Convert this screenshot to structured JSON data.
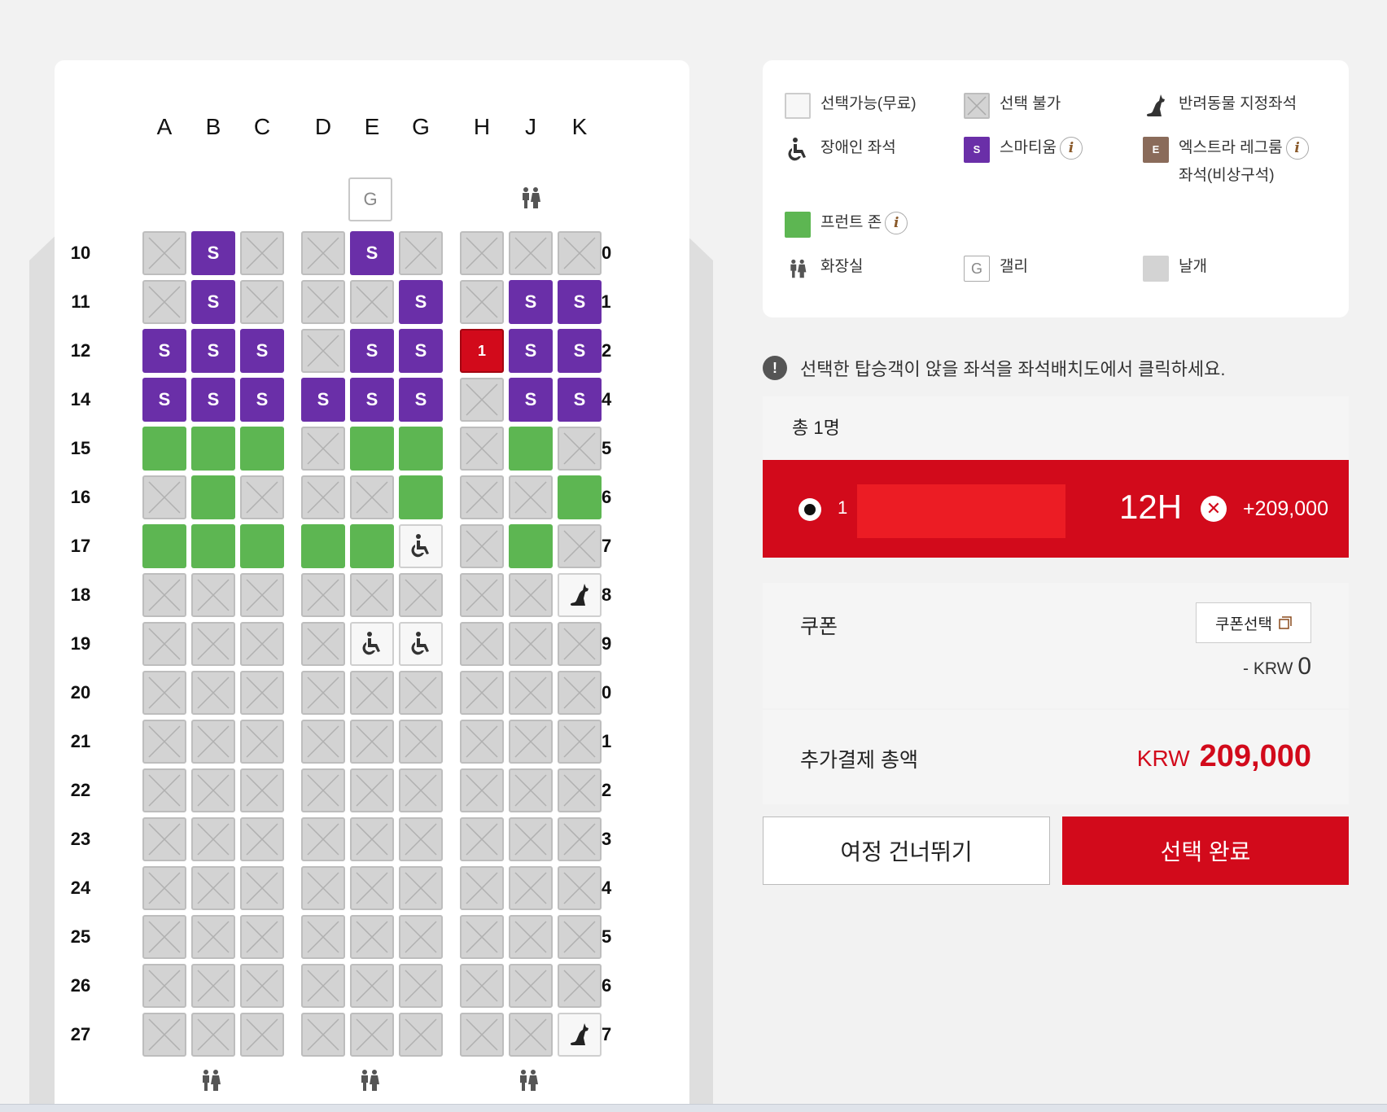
{
  "seatmap": {
    "columns": [
      "A",
      "B",
      "C",
      "D",
      "E",
      "G",
      "H",
      "J",
      "K"
    ],
    "galley_label": "G",
    "rows": [
      {
        "num": "10",
        "seats": [
          "X",
          "S",
          "X",
          "X",
          "S",
          "X",
          "X",
          "X",
          "X"
        ]
      },
      {
        "num": "11",
        "seats": [
          "X",
          "S",
          "X",
          "X",
          "X",
          "S",
          "X",
          "S",
          "S"
        ]
      },
      {
        "num": "12",
        "seats": [
          "S",
          "S",
          "S",
          "X",
          "S",
          "S",
          "SEL",
          "S",
          "S"
        ]
      },
      {
        "num": "14",
        "seats": [
          "S",
          "S",
          "S",
          "S",
          "S",
          "S",
          "X",
          "S",
          "S"
        ]
      },
      {
        "num": "15",
        "seats": [
          "F",
          "F",
          "F",
          "X",
          "F",
          "F",
          "X",
          "F",
          "X"
        ]
      },
      {
        "num": "16",
        "seats": [
          "X",
          "F",
          "X",
          "X",
          "X",
          "F",
          "X",
          "X",
          "F"
        ]
      },
      {
        "num": "17",
        "seats": [
          "F",
          "F",
          "F",
          "F",
          "F",
          "W",
          "X",
          "F",
          "X"
        ]
      },
      {
        "num": "18",
        "seats": [
          "X",
          "X",
          "X",
          "X",
          "X",
          "X",
          "X",
          "X",
          "P"
        ]
      },
      {
        "num": "19",
        "seats": [
          "X",
          "X",
          "X",
          "X",
          "W",
          "W",
          "X",
          "X",
          "X"
        ]
      },
      {
        "num": "20",
        "seats": [
          "X",
          "X",
          "X",
          "X",
          "X",
          "X",
          "X",
          "X",
          "X"
        ]
      },
      {
        "num": "21",
        "seats": [
          "X",
          "X",
          "X",
          "X",
          "X",
          "X",
          "X",
          "X",
          "X"
        ]
      },
      {
        "num": "22",
        "seats": [
          "X",
          "X",
          "X",
          "X",
          "X",
          "X",
          "X",
          "X",
          "X"
        ]
      },
      {
        "num": "23",
        "seats": [
          "X",
          "X",
          "X",
          "X",
          "X",
          "X",
          "X",
          "X",
          "X"
        ]
      },
      {
        "num": "24",
        "seats": [
          "X",
          "X",
          "X",
          "X",
          "X",
          "X",
          "X",
          "X",
          "X"
        ]
      },
      {
        "num": "25",
        "seats": [
          "X",
          "X",
          "X",
          "X",
          "X",
          "X",
          "X",
          "X",
          "X"
        ]
      },
      {
        "num": "26",
        "seats": [
          "X",
          "X",
          "X",
          "X",
          "X",
          "X",
          "X",
          "X",
          "X"
        ]
      },
      {
        "num": "27",
        "seats": [
          "X",
          "X",
          "X",
          "X",
          "X",
          "X",
          "X",
          "X",
          "P"
        ]
      }
    ],
    "smarteum_mark": "S",
    "selected_mark": "1"
  },
  "legend": {
    "available": "선택가능(무료)",
    "unavailable": "선택 불가",
    "pet": "반려동물 지정좌석",
    "disabled": "장애인 좌석",
    "smarteum": "스마티움",
    "smarteum_badge": "S",
    "extra_legroom": "엑스트라 레그룸",
    "extra_legroom_sub": "좌석(비상구석)",
    "extra_badge": "E",
    "front_zone": "프런트 존",
    "restroom": "화장실",
    "galley": "갤리",
    "galley_badge": "G",
    "wing": "날개",
    "info_mark": "i"
  },
  "notice": "선택한 탑승객이 앉을 좌석을 좌석배치도에서 클릭하세요.",
  "notice_icon": "!",
  "total_count": "총 1명",
  "passenger": {
    "num": "1",
    "seat": "12H",
    "price": "+209,000"
  },
  "coupon": {
    "label": "쿠폰",
    "button": "쿠폰선택",
    "prefix": "- KRW",
    "amount": "0"
  },
  "summary": {
    "label": "추가결제 총액",
    "currency": "KRW",
    "amount": "209,000"
  },
  "buttons": {
    "skip": "여정 건너뛰기",
    "done": "선택 완료"
  },
  "colors": {
    "smarteum": "#6a2fa8",
    "front_zone": "#5db652",
    "selected": "#d20a1b",
    "unavailable": "#d3d3d3"
  }
}
